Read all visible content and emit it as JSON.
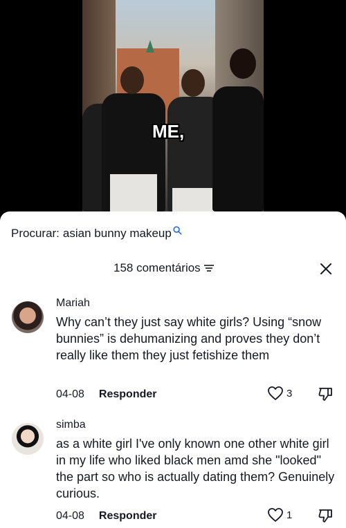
{
  "video": {
    "caption": "ME,"
  },
  "search": {
    "label": "Procurar:",
    "query": "asian bunny makeup"
  },
  "comments_header": {
    "count_label": "158 comentários"
  },
  "comments": [
    {
      "username": "Mariah",
      "text": "Why can’t they just say white girls? Using “snow bunnies” is dehumanizing and proves they don’t really like them they just fetishize them",
      "date": "04-08",
      "reply_label": "Responder",
      "likes": "3"
    },
    {
      "username": "simba",
      "text": "as a white girl I've only known one other white girl in my life who liked black men amd she \"looked\" the part so who is actually dating them? Genuinely curious.",
      "date": "04-08",
      "reply_label": "Responder",
      "likes": "1"
    }
  ],
  "colors": {
    "text": "#161823",
    "search_accent": "#2b6fe0",
    "sheet": "#ffffff",
    "backdrop": "#000000"
  },
  "icons": [
    "search-icon",
    "filter-icon",
    "close-icon",
    "heart-icon",
    "dislike-icon"
  ]
}
